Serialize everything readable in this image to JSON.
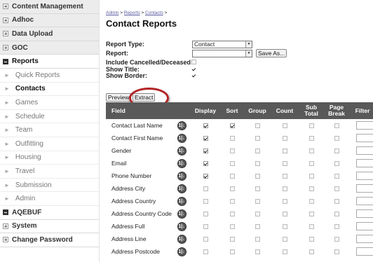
{
  "sidebar": {
    "top_items": [
      {
        "label": "Content Management"
      },
      {
        "label": "Adhoc"
      },
      {
        "label": "Data Upload"
      },
      {
        "label": "GOC"
      },
      {
        "label": "Reports"
      }
    ],
    "sub_items": [
      {
        "label": "Quick Reports"
      },
      {
        "label": "Contacts"
      },
      {
        "label": "Games"
      },
      {
        "label": "Schedule"
      },
      {
        "label": "Team"
      },
      {
        "label": "Outfitting"
      },
      {
        "label": "Housing"
      },
      {
        "label": "Travel"
      },
      {
        "label": "Submission"
      },
      {
        "label": "Admin"
      }
    ],
    "bottom_items": [
      {
        "label": "AQEBUF"
      },
      {
        "label": "System"
      },
      {
        "label": "Change Password"
      }
    ]
  },
  "breadcrumb": {
    "admin": "Admin",
    "reports": "Reports",
    "contacts": "Contacts",
    "sep": ">"
  },
  "page_title": "Contact Reports",
  "form": {
    "report_type_label": "Report Type:",
    "report_type_value": "Contact",
    "report_label": "Report:",
    "report_value": "",
    "save_as_label": "Save As...",
    "include_cancelled_label": "Include Cancelled/Deceased:",
    "include_cancelled_checked": false,
    "show_title_label": "Show Title:",
    "show_title_checked": true,
    "show_border_label": "Show Border:",
    "show_border_checked": true
  },
  "actions": {
    "preview_label": "Preview",
    "extract_label": "Extract"
  },
  "grid": {
    "columns": [
      "Field",
      "Display",
      "Sort",
      "Group",
      "Count",
      "Sub Total",
      "Page Break",
      "Filter"
    ],
    "rows": [
      {
        "field": "Contact Last Name",
        "display": true,
        "sort": true
      },
      {
        "field": "Contact First Name",
        "display": true,
        "sort": false
      },
      {
        "field": "Gender",
        "display": true,
        "sort": false
      },
      {
        "field": "Email",
        "display": true,
        "sort": false
      },
      {
        "field": "Phone Number",
        "display": true,
        "sort": false
      },
      {
        "field": "Address City",
        "display": false,
        "sort": false
      },
      {
        "field": "Address Country",
        "display": false,
        "sort": false
      },
      {
        "field": "Address Country Code",
        "display": false,
        "sort": false
      },
      {
        "field": "Address Full",
        "display": false,
        "sort": false
      },
      {
        "field": "Address Line",
        "display": false,
        "sort": false
      },
      {
        "field": "Address Postcode",
        "display": false,
        "sort": false
      }
    ],
    "sort_icon_glyph": "1|↓"
  },
  "colors": {
    "header_bg": "#595959",
    "highlight": "#b32424",
    "sidebar_bg": "#ececec"
  }
}
